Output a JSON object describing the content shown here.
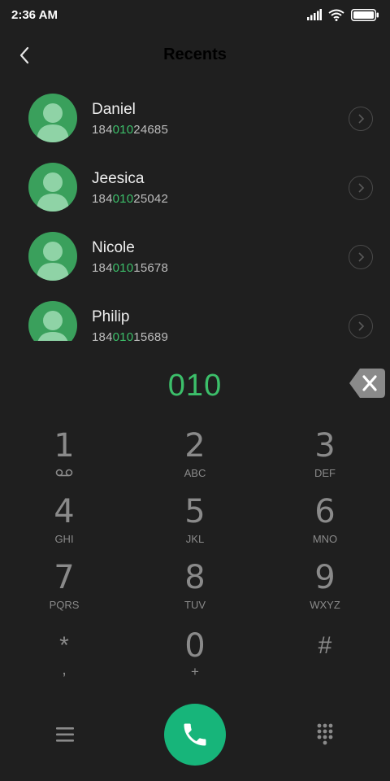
{
  "status_bar": {
    "time": "2:36 AM"
  },
  "header": {
    "title": "Recents"
  },
  "recents": [
    {
      "name": "Daniel",
      "number_prefix": "184",
      "number_match": "010",
      "number_suffix": "24685"
    },
    {
      "name": "Jeesica",
      "number_prefix": "184",
      "number_match": "010",
      "number_suffix": "25042"
    },
    {
      "name": "Nicole",
      "number_prefix": "184",
      "number_match": "010",
      "number_suffix": "15678"
    },
    {
      "name": "Philip",
      "number_prefix": "184",
      "number_match": "010",
      "number_suffix": "15689"
    }
  ],
  "dialer": {
    "input": "010"
  },
  "keypad": {
    "keys": [
      {
        "digit": "1",
        "letters": ""
      },
      {
        "digit": "2",
        "letters": "ABC"
      },
      {
        "digit": "3",
        "letters": "DEF"
      },
      {
        "digit": "4",
        "letters": "GHI"
      },
      {
        "digit": "5",
        "letters": "JKL"
      },
      {
        "digit": "6",
        "letters": "MNO"
      },
      {
        "digit": "7",
        "letters": "PQRS"
      },
      {
        "digit": "8",
        "letters": "TUV"
      },
      {
        "digit": "9",
        "letters": "WXYZ"
      },
      {
        "digit": "*",
        "letters": ","
      },
      {
        "digit": "0",
        "letters": "+"
      },
      {
        "digit": "#",
        "letters": ""
      }
    ]
  },
  "colors": {
    "background": "#1f1f1f",
    "accent": "#3cbf6a",
    "call_button": "#17b57a",
    "avatar": "#3aa05c"
  },
  "icons": {
    "back": "chevron-left-icon",
    "detail": "chevron-right-icon",
    "backspace": "backspace-icon",
    "voicemail": "voicemail-icon",
    "menu": "menu-icon",
    "call": "phone-icon",
    "dialpad": "dialpad-icon"
  }
}
